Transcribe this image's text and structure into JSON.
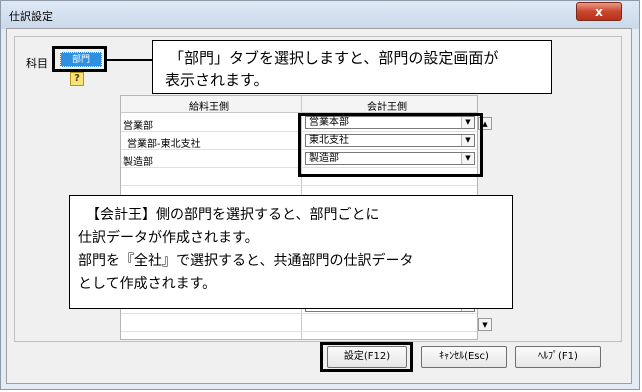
{
  "window": {
    "title": "仕訳設定",
    "close_label": "x"
  },
  "panel": {
    "field_label": "科目",
    "tab_label": "部門",
    "help_icon": "help-question-icon"
  },
  "grid": {
    "left_header": "給料王側",
    "right_header": "会計王側",
    "rows": [
      {
        "left": "営業部",
        "right": "営業本部"
      },
      {
        "left": "営業部-東北支社",
        "right": "東北支社"
      },
      {
        "left": "製造部",
        "right": "製造部"
      }
    ]
  },
  "callout_top": {
    "line1": "「部門」タブを選択しますと、部門の設定画面が",
    "line2": "表示されます。"
  },
  "callout_mid": {
    "line1": "【会計王】側の部門を選択すると、部門ごとに",
    "line2": "仕訳データが作成されます。",
    "line3": "部門を『全社』で選択すると、共通部門の仕訳データ",
    "line4": "として作成されます。"
  },
  "buttons": {
    "ok": "設定(F12)",
    "cancel": "ｷｬﾝｾﾙ(Esc)",
    "help": "ﾍﾙﾌﾟ(F1)"
  }
}
